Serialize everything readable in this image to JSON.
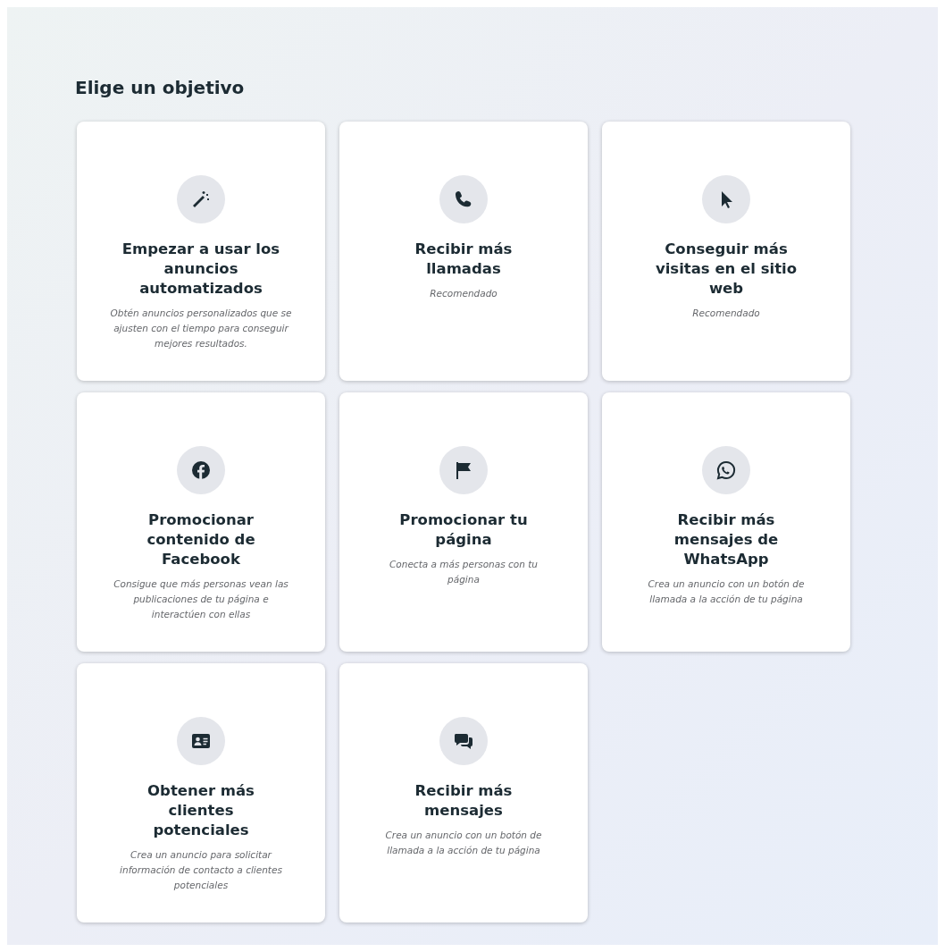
{
  "heading": "Elige un objetivo",
  "objectives": [
    {
      "kind": "wand",
      "title": "Empezar a usar los anuncios automatizados",
      "description": "Obtén anuncios personalizados que se ajusten con el tiempo para conseguir mejores resultados."
    },
    {
      "kind": "phone",
      "title": "Recibir más llamadas",
      "description": "Recomendado"
    },
    {
      "kind": "cursor",
      "title": "Conseguir más visitas en el sitio web",
      "description": "Recomendado"
    },
    {
      "kind": "facebook",
      "title": "Promocionar contenido de Facebook",
      "description": "Consigue que más personas vean las publicaciones de tu página e interactúen con ellas"
    },
    {
      "kind": "flag",
      "title": "Promocionar tu página",
      "description": "Conecta a más personas con tu página"
    },
    {
      "kind": "whatsapp",
      "title": "Recibir más mensajes de WhatsApp",
      "description": "Crea un anuncio con un botón de llamada a la acción de tu página"
    },
    {
      "kind": "contact",
      "title": "Obtener más clientes potenciales",
      "description": "Crea un anuncio para solicitar información de contacto a clientes potenciales"
    },
    {
      "kind": "chat",
      "title": "Recibir más mensajes",
      "description": "Crea un anuncio con un botón de llamada a la acción de tu página"
    }
  ]
}
